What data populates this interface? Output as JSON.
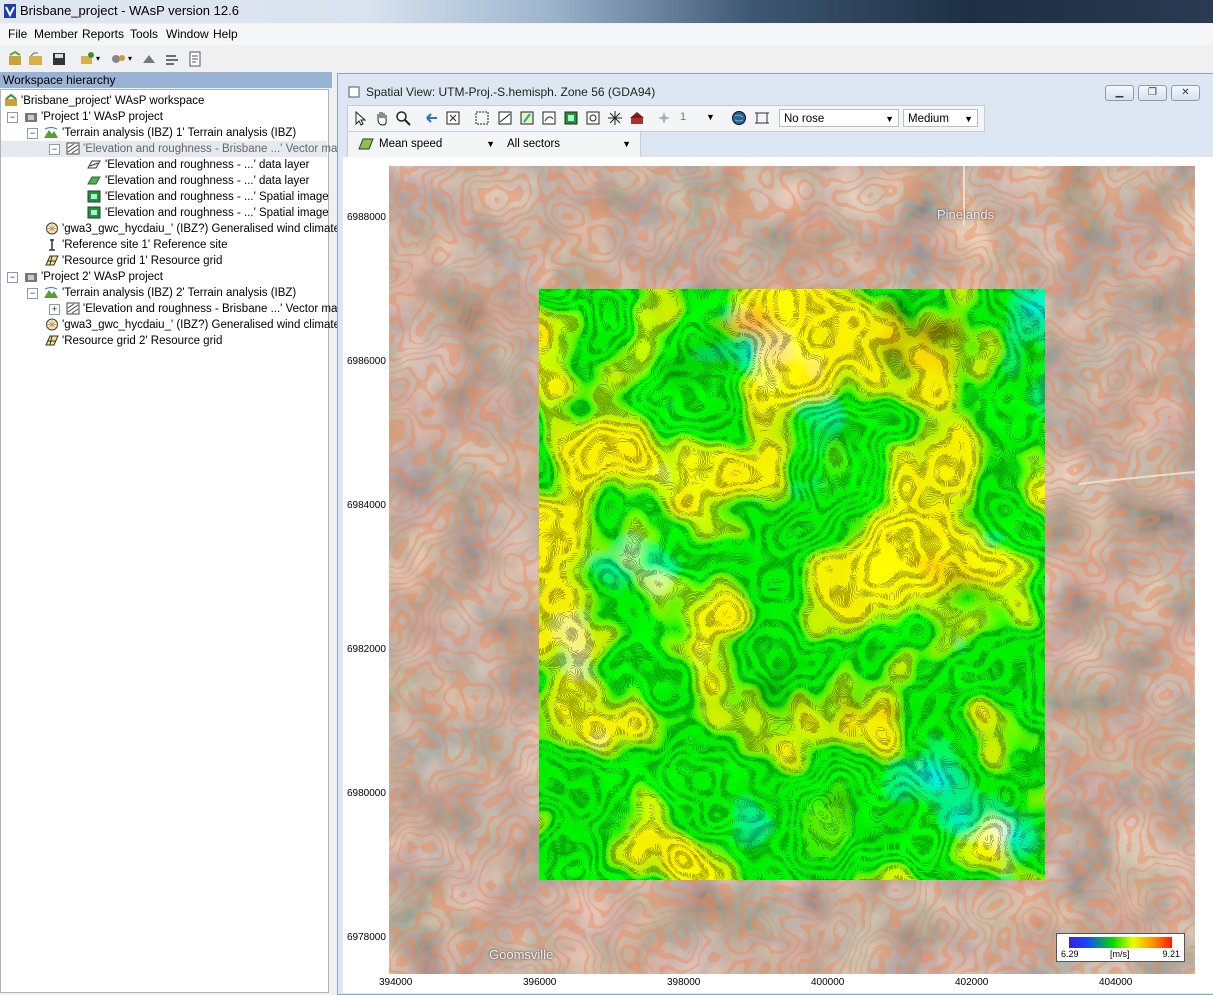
{
  "window": {
    "title": "Brisbane_project - WAsP version 12.6"
  },
  "menu": [
    "File",
    "Member",
    "Reports",
    "Tools",
    "Window",
    "Help"
  ],
  "workspace": {
    "header": "Workspace hierarchy",
    "rows": [
      "'Brisbane_project' WAsP workspace",
      "'Project 1' WAsP project",
      "'Terrain analysis (IBZ) 1' Terrain analysis (IBZ)",
      "'Elevation and roughness - Brisbane ...' Vector map",
      "'Elevation and roughness - ...' data layer",
      "'Elevation and roughness - ...' data layer",
      "'Elevation and roughness - ...' Spatial image",
      "'Elevation and roughness - ...' Spatial image",
      "'gwa3_gwc_hycdaiu_' (IBZ?) Generalised wind climate",
      "'Reference site 1' Reference site",
      "'Resource grid 1' Resource grid",
      "'Project 2' WAsP project",
      "'Terrain analysis (IBZ) 2' Terrain analysis (IBZ)",
      "'Elevation and roughness - Brisbane ...' Vector map",
      "'gwa3_gwc_hycdaiu_' (IBZ?) Generalised wind climate",
      "'Resource grid 2' Resource grid"
    ]
  },
  "spatial_view": {
    "title": "Spatial View: UTM-Proj.-S.hemisph. Zone 56 (GDA94)",
    "sector_number": "1",
    "rose_select": "No rose",
    "size_select": "Medium",
    "variable_select": "Mean speed",
    "sectors_select": "All sectors",
    "y_ticks": [
      "6988000",
      "6986000",
      "6984000",
      "6982000",
      "6980000",
      "6978000"
    ],
    "x_ticks": [
      "394000",
      "396000",
      "398000",
      "400000",
      "402000",
      "404000"
    ],
    "places": [
      "Pinelands",
      "Goomsville"
    ],
    "legend": {
      "min": "6.29",
      "unit": "[m/s]",
      "max": "9.21"
    }
  },
  "colors": {
    "accent": "#98b3d3",
    "low": "#3a1fd8",
    "mid": "#00d700",
    "high": "#ff1a00"
  }
}
